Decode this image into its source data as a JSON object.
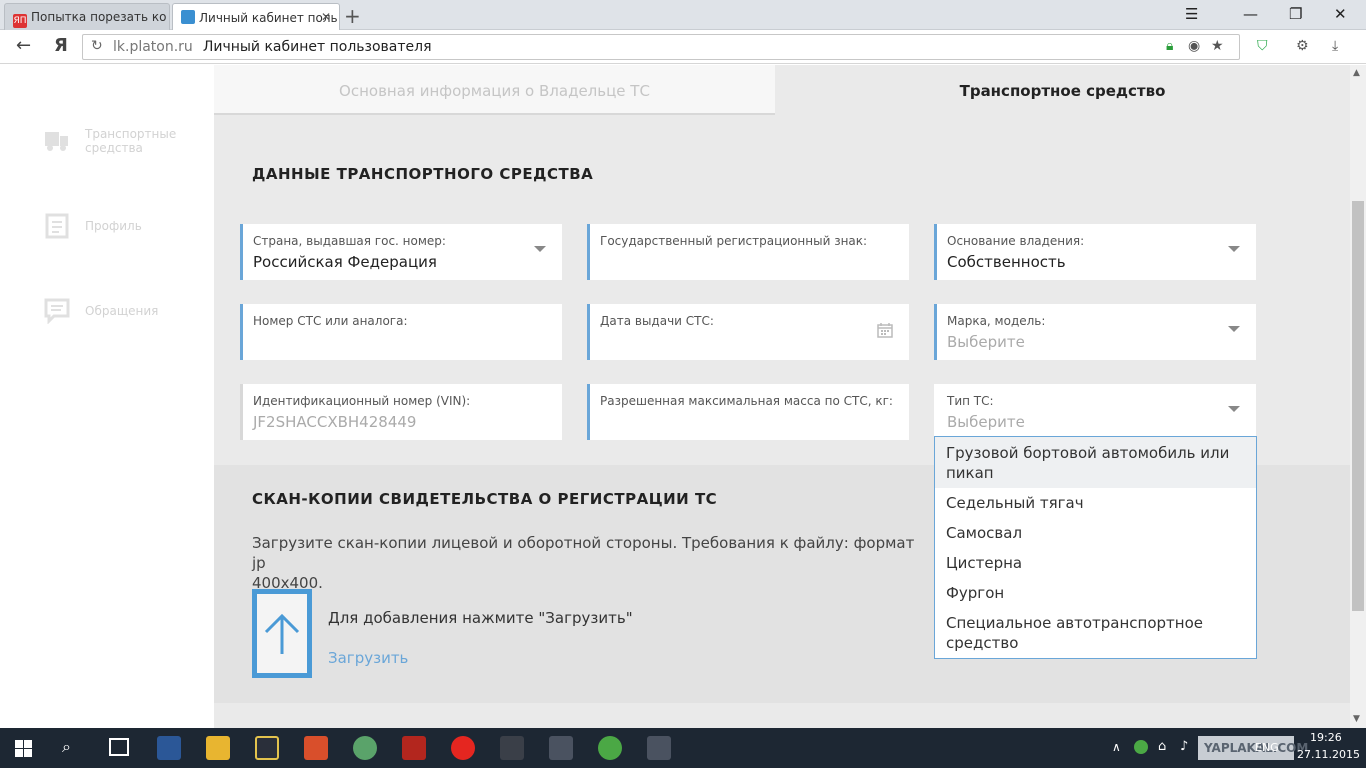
{
  "browser": {
    "tabs": [
      {
        "title": "Попытка порезать ко",
        "active": false
      },
      {
        "title": "Личный кабинет поль",
        "active": true
      }
    ],
    "url_domain": "lk.platon.ru",
    "url_title": "Личный кабинет пользователя"
  },
  "sidebar": {
    "items": [
      {
        "label": "Транспортные средства",
        "icon": "truck-icon"
      },
      {
        "label": "Профиль",
        "icon": "profile-icon"
      },
      {
        "label": "Обращения",
        "icon": "message-icon"
      }
    ]
  },
  "page_tabs": {
    "owner": "Основная информация о Владельце ТС",
    "vehicle": "Транспортное средство"
  },
  "vehicle_section": {
    "title": "ДАННЫЕ ТРАНСПОРТНОГО СРЕДСТВА",
    "fields": {
      "country": {
        "label": "Страна, выдавшая гос. номер:",
        "value": "Российская Федерация"
      },
      "reg_plate": {
        "label": "Государственный регистрационный знак:",
        "value": ""
      },
      "ownership": {
        "label": "Основание владения:",
        "value": "Собственность"
      },
      "sts_number": {
        "label": "Номер СТС или аналога:",
        "value": ""
      },
      "sts_date": {
        "label": "Дата выдачи СТС:",
        "value": ""
      },
      "brand_model": {
        "label": "Марка, модель:",
        "placeholder": "Выберите"
      },
      "vin": {
        "label": "Идентификационный номер (VIN):",
        "value": "JF2SHACCXBH428449"
      },
      "max_mass": {
        "label": "Разрешенная максимальная масса по СТС, кг:",
        "value": ""
      },
      "vehicle_type": {
        "label": "Тип ТС:",
        "placeholder": "Выберите"
      }
    }
  },
  "scan_section": {
    "title": "СКАН-КОПИИ СВИДЕТЕЛЬСТВА О РЕГИСТРАЦИИ ТС",
    "description": "Загрузите скан-копии лицевой и оборотной стороны. Требования к файлу: формат jp",
    "description_line2": "400x400.",
    "upload_hint": "Для добавления нажмите \"Загрузить\"",
    "upload_link": "Загрузить"
  },
  "vehicle_type_options": [
    "Грузовой бортовой автомобиль или пикап",
    "Седельный тягач",
    "Самосвал",
    "Цистерна",
    "Фургон",
    "Специальное автотранспортное средство"
  ],
  "taskbar": {
    "language": "ENG",
    "time": "19:26",
    "date": "27.11.2015",
    "watermark": "YAPLAKAL.COM"
  },
  "colors": {
    "accent": "#6aa6d8",
    "upload_border": "#4a9ad6",
    "taskbar": "#1d2733"
  }
}
